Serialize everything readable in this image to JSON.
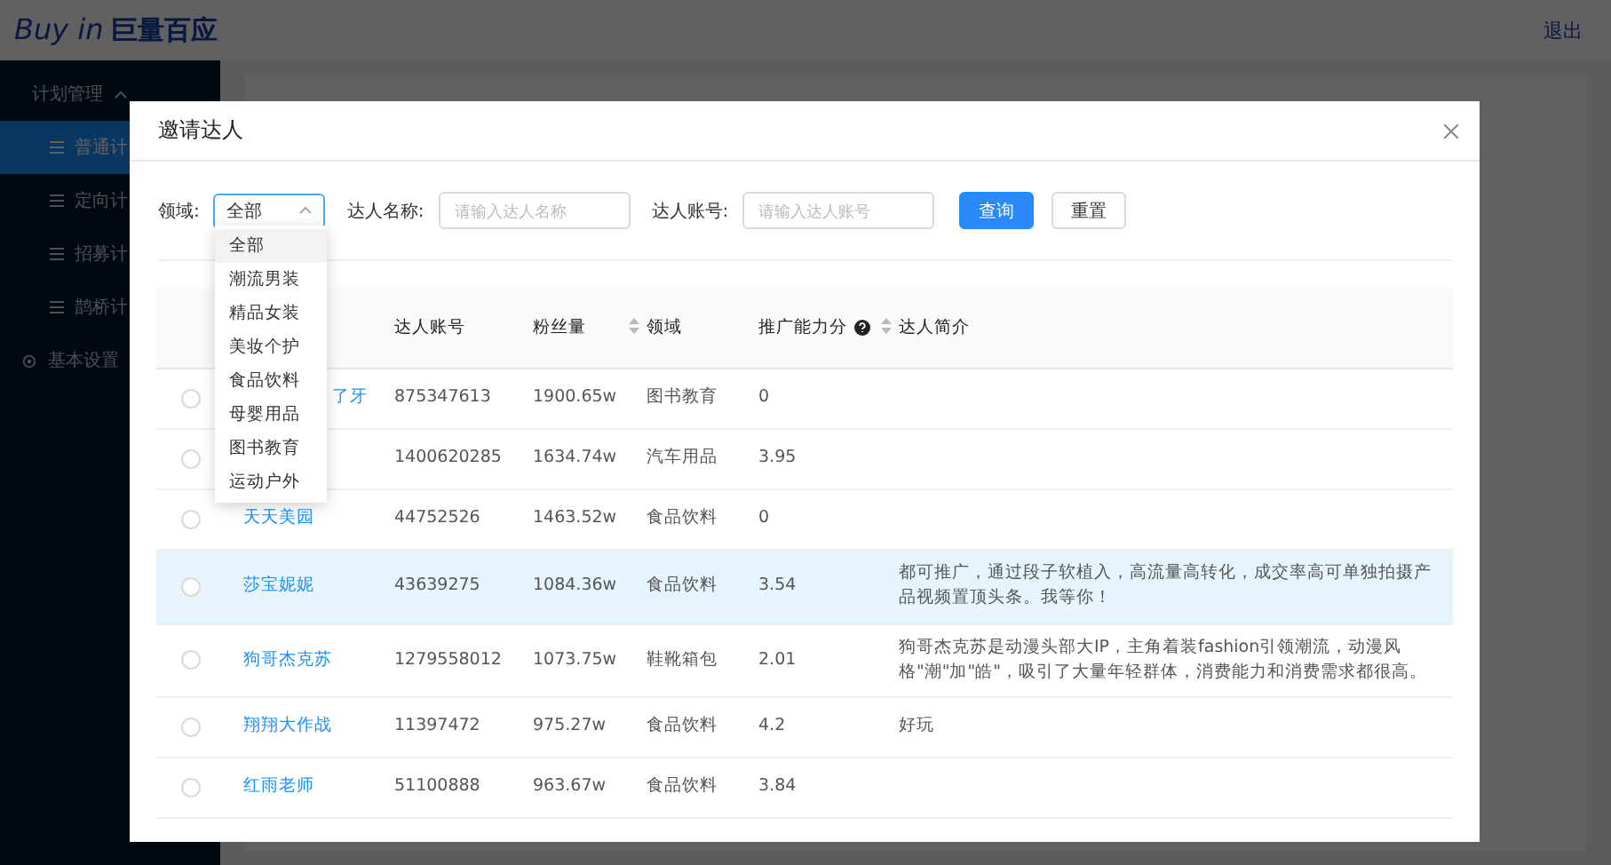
{
  "header": {
    "logo": "Buy in",
    "logo_cn": "巨量百应",
    "logout": "退出"
  },
  "sidebar": {
    "items": [
      {
        "label": "计划管理",
        "expanded": true,
        "children": [
          {
            "label": "普通计",
            "selected": true
          },
          {
            "label": "定向计",
            "selected": false
          },
          {
            "label": "招募计",
            "selected": false
          },
          {
            "label": "鹊桥计",
            "selected": false
          }
        ]
      },
      {
        "label": "基本设置"
      }
    ]
  },
  "modal": {
    "title": "邀请达人",
    "filters": {
      "domain_label": "领域:",
      "domain_value": "全部",
      "domain_open": true,
      "domain_options": [
        {
          "label": "全部",
          "selected": true
        },
        {
          "label": "潮流男装",
          "selected": false
        },
        {
          "label": "精品女装",
          "selected": false
        },
        {
          "label": "美妆个护",
          "selected": false
        },
        {
          "label": "食品饮料",
          "selected": false
        },
        {
          "label": "母婴用品",
          "selected": false
        },
        {
          "label": "图书教育",
          "selected": false
        },
        {
          "label": "运动户外",
          "selected": false
        }
      ],
      "name_label": "达人名称:",
      "name_placeholder": "请输入达人名称",
      "account_label": "达人账号:",
      "account_placeholder": "请输入达人账号",
      "search_button": "查询",
      "reset_button": "重置"
    },
    "table": {
      "columns": [
        {
          "label": "达人账号",
          "sortable": false,
          "help": false
        },
        {
          "label": "粉丝量",
          "sortable": true,
          "help": false
        },
        {
          "label": "领域",
          "sortable": false,
          "help": false
        },
        {
          "label": "推广能力分",
          "sortable": true,
          "help": true
        },
        {
          "label": "达人简介",
          "sortable": false,
          "help": false
        }
      ],
      "rows": [
        {
          "name": "了牙",
          "account": "875347613",
          "fans": "1900.65w",
          "domain": "图书教育",
          "score": "0",
          "intro": "",
          "highlighted": false
        },
        {
          "name": "",
          "account": "1400620285",
          "fans": "1634.74w",
          "domain": "汽车用品",
          "score": "3.95",
          "intro": "",
          "highlighted": false
        },
        {
          "name": "天天美园",
          "account": "44752526",
          "fans": "1463.52w",
          "domain": "食品饮料",
          "score": "0",
          "intro": "",
          "highlighted": false
        },
        {
          "name": "莎宝妮妮",
          "account": "43639275",
          "fans": "1084.36w",
          "domain": "食品饮料",
          "score": "3.54",
          "intro": "都可推广，通过段子软植入，高流量高转化，成交率高可单独拍摄产品视频置顶头条。我等你！",
          "highlighted": true
        },
        {
          "name": "狗哥杰克苏",
          "account": "1279558012",
          "fans": "1073.75w",
          "domain": "鞋靴箱包",
          "score": "2.01",
          "intro": "狗哥杰克苏是动漫头部大IP，主角着装fashion引领潮流，动漫风格\"潮\"加\"皓\"，吸引了大量年轻群体，消费能力和消费需求都很高。",
          "highlighted": false
        },
        {
          "name": "翔翔大作战",
          "account": "11397472",
          "fans": "975.27w",
          "domain": "食品饮料",
          "score": "4.2",
          "intro": "好玩",
          "highlighted": false
        },
        {
          "name": "红雨老师",
          "account": "51100888",
          "fans": "963.67w",
          "domain": "食品饮料",
          "score": "3.84",
          "intro": "",
          "highlighted": false
        }
      ]
    }
  }
}
